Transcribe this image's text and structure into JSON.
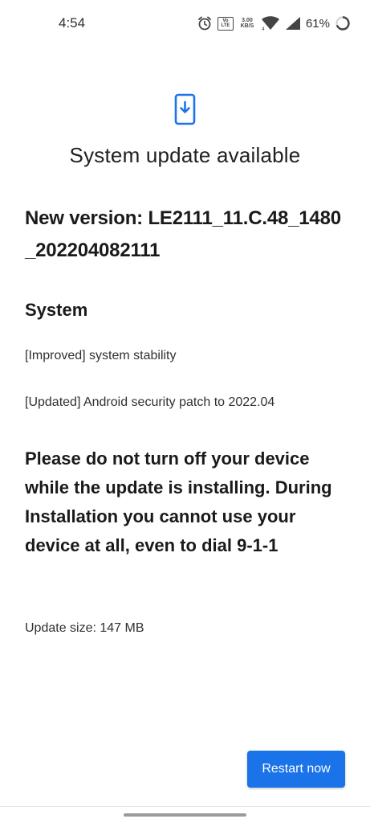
{
  "status_bar": {
    "time": "4:54",
    "volte_label": "Vo LTE",
    "net_speed_value": "3.00",
    "net_speed_unit": "KB/S",
    "network_type": "4",
    "battery_percent": "61%",
    "icons": [
      "alarm-icon",
      "volte-icon",
      "wifi-icon",
      "signal-icon",
      "battery-icon"
    ]
  },
  "header": {
    "icon": "phone-download-icon",
    "title": "System update available"
  },
  "update": {
    "version": "New version: LE2111_11.C.48_1480_202204082111",
    "section_title": "System",
    "notes": [
      "[Improved] system stability",
      "[Updated] Android security patch to 2022.04"
    ],
    "warning": "Please do not turn off your device while the update is installing. During Installation you cannot use your device at all, even to dial 9-1-1",
    "size_text": "Update size: 147 MB"
  },
  "actions": {
    "restart_label": "Restart now"
  },
  "colors": {
    "accent": "#1a73e8",
    "background": "#ffffff",
    "text": "#1a1a1a"
  }
}
